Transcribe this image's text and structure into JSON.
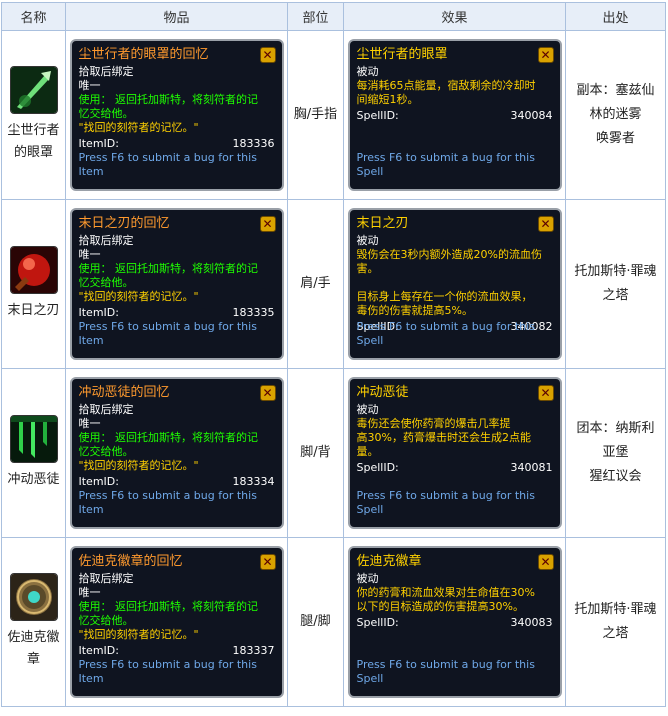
{
  "headers": [
    "名称",
    "物品",
    "部位",
    "效果",
    "出处"
  ],
  "close_glyph": "✕",
  "rows": [
    {
      "name_lines": [
        "尘世行者",
        "的眼罩"
      ],
      "icon": "green-blade-icon",
      "item": {
        "title": "尘世行者的眼罩的回忆",
        "bind": "拾取后绑定",
        "unique": "唯一",
        "use_lines": [
          "使用： 返回托加斯特，将刻符者的记",
          "忆交给他。"
        ],
        "quote": "\"找回的刻符者的记忆。\"",
        "id_label": "ItemID:",
        "id_value": "183336",
        "bug": "Press F6 to submit a bug for this Item"
      },
      "part": "胸/手指",
      "effect": {
        "title": "尘世行者的眼罩",
        "passive": "被动",
        "desc_lines": [
          "每消耗65点能量，宿敌剩余的冷却时",
          "间缩短1秒。"
        ],
        "id_label": "SpellID:",
        "id_value": "340084",
        "bug": "Press F6 to submit a bug for this Spell"
      },
      "source_lines": [
        "副本：塞兹仙",
        "林的迷雾",
        "唤雾者"
      ]
    },
    {
      "name_lines": [
        "末日之刃"
      ],
      "icon": "red-orb-icon",
      "item": {
        "title": "末日之刃的回忆",
        "bind": "拾取后绑定",
        "unique": "唯一",
        "use_lines": [
          "使用： 返回托加斯特，将刻符者的记",
          "忆交给他。"
        ],
        "quote": "\"找回的刻符者的记忆。\"",
        "id_label": "ItemID:",
        "id_value": "183335",
        "bug": "Press F6 to submit a bug for this Item"
      },
      "part": "肩/手",
      "effect": {
        "title": "末日之刃",
        "passive": "被动",
        "desc_lines": [
          "毁伤会在3秒内额外造成20%的流血伤",
          "害。",
          "",
          "目标身上每存在一个你的流血效果，",
          "毒伤的伤害就提高5%。"
        ],
        "id_label": "SpellID:",
        "id_value": "340082",
        "bug": "Press F6 to submit a bug for this Spell"
      },
      "source_lines": [
        "托加斯特·罪魂",
        "之塔"
      ]
    },
    {
      "name_lines": [
        "冲动恶徒"
      ],
      "icon": "green-drip-icon",
      "item": {
        "title": "冲动恶徒的回忆",
        "bind": "拾取后绑定",
        "unique": "唯一",
        "use_lines": [
          "使用： 返回托加斯特，将刻符者的记",
          "忆交给他。"
        ],
        "quote": "\"找回的刻符者的记忆。\"",
        "id_label": "ItemID:",
        "id_value": "183334",
        "bug": "Press F6 to submit a bug for this Item"
      },
      "part": "脚/背",
      "effect": {
        "title": "冲动恶徒",
        "passive": "被动",
        "desc_lines": [
          "毒伤还会使你药膏的爆击几率提",
          "高30%，药膏爆击时还会生成2点能",
          "量。"
        ],
        "id_label": "SpellID:",
        "id_value": "340081",
        "bug": "Press F6 to submit a bug for this Spell"
      },
      "source_lines": [
        "团本：纳斯利",
        "亚堡",
        "猩红议会"
      ]
    },
    {
      "name_lines": [
        "佐迪克徽",
        "章"
      ],
      "icon": "bronze-medallion-icon",
      "item": {
        "title": "佐迪克徽章的回忆",
        "bind": "拾取后绑定",
        "unique": "唯一",
        "use_lines": [
          "使用： 返回托加斯特，将刻符者的记",
          "忆交给他。"
        ],
        "quote": "\"找回的刻符者的记忆。\"",
        "id_label": "ItemID:",
        "id_value": "183337",
        "bug": "Press F6 to submit a bug for this Item"
      },
      "part": "腿/脚",
      "effect": {
        "title": "佐迪克徽章",
        "passive": "被动",
        "desc_lines": [
          "你的药膏和流血效果对生命值在30%",
          "以下的目标造成的伤害提高30%。"
        ],
        "id_label": "SpellID:",
        "id_value": "340083",
        "bug": "Press F6 to submit a bug for this Spell"
      },
      "source_lines": [
        "托加斯特·罪魂",
        "之塔"
      ]
    }
  ]
}
